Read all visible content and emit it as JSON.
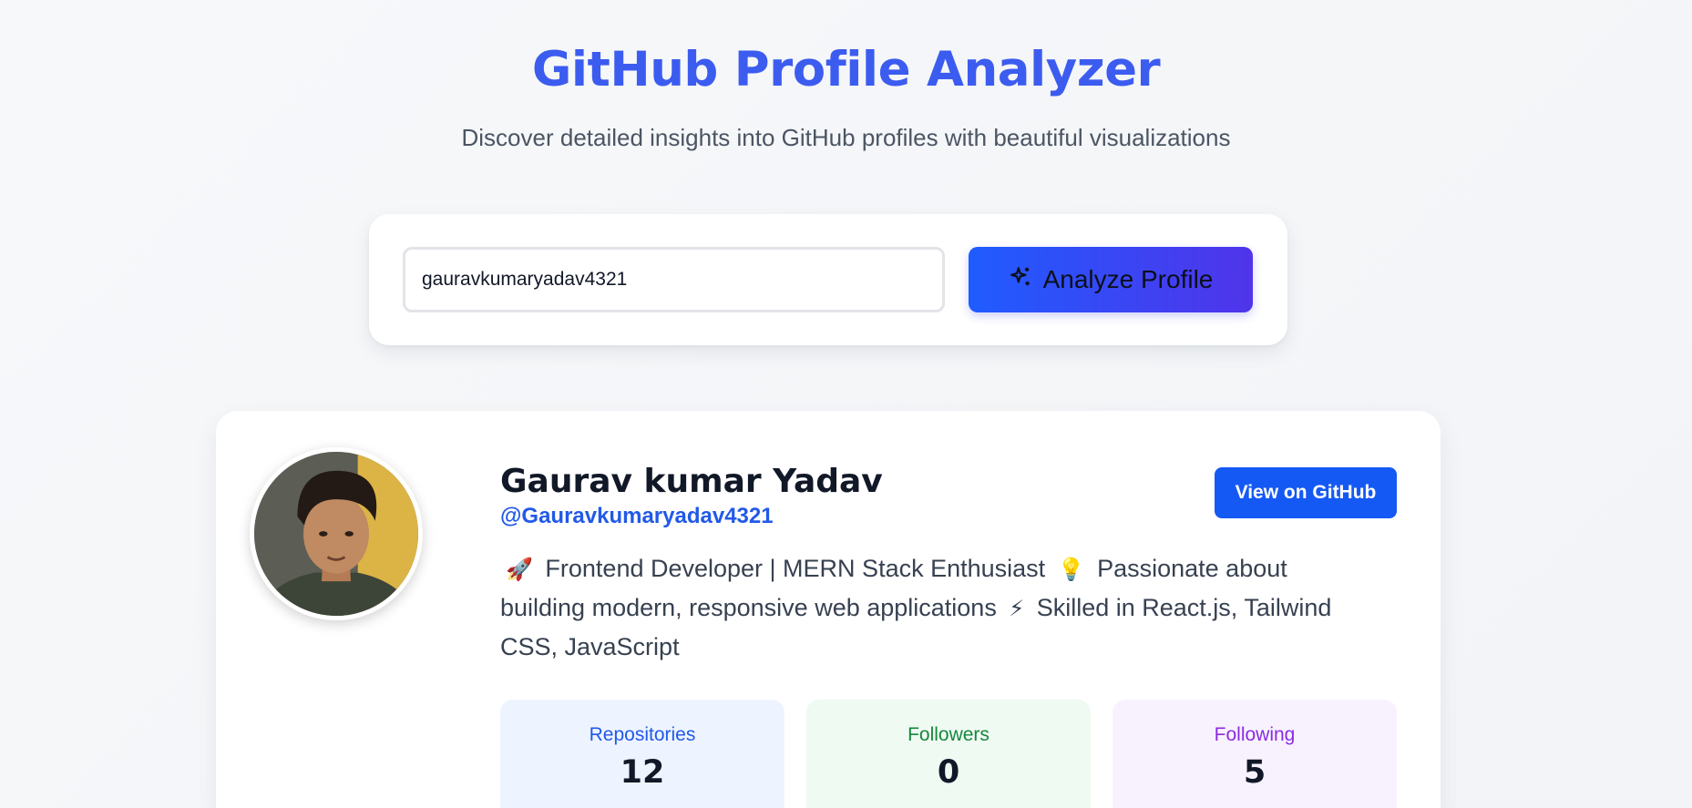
{
  "header": {
    "title": "GitHub Profile Analyzer",
    "subtitle": "Discover detailed insights into GitHub profiles with beautiful visualizations"
  },
  "search": {
    "value": "gauravkumaryadav4321",
    "button_label": "Analyze Profile",
    "button_icon": "sparkles-icon"
  },
  "profile": {
    "name": "Gaurav kumar Yadav",
    "handle": "@Gauravkumaryadav4321",
    "view_button_label": "View on GitHub",
    "bio": {
      "emoji1": "🚀",
      "part1": "Frontend Developer | MERN Stack Enthusiast",
      "emoji2": "💡",
      "part2": "Passionate about building modern, responsive web applications",
      "emoji3": "⚡",
      "part3": "Skilled in React.js, Tailwind CSS, JavaScript"
    },
    "stats": [
      {
        "label": "Repositories",
        "value": "12"
      },
      {
        "label": "Followers",
        "value": "0"
      },
      {
        "label": "Following",
        "value": "5"
      }
    ]
  },
  "colors": {
    "title": "#3c5cf0",
    "accent_blue": "#1559f5",
    "gradient_start": "#1f5cff",
    "gradient_end": "#5034ea",
    "repos": "#2159e8",
    "followers": "#16873e",
    "following": "#8a2be2"
  }
}
